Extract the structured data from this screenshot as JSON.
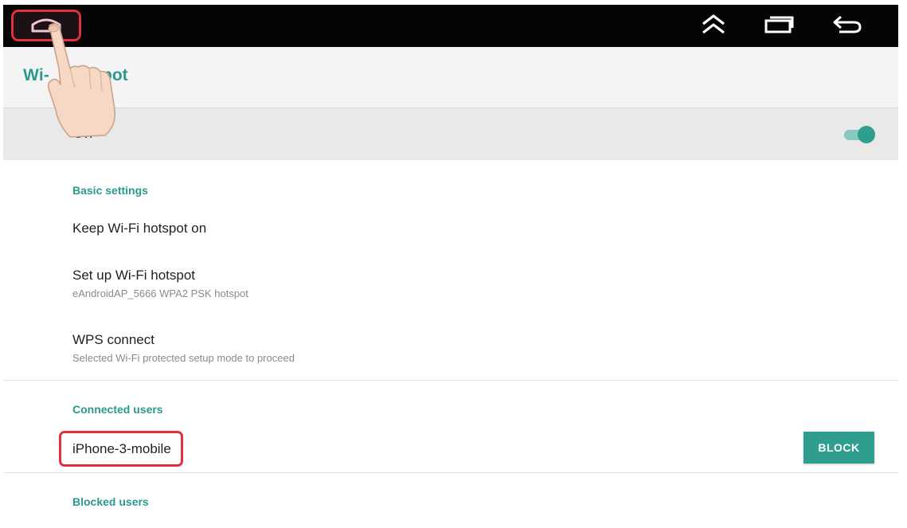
{
  "nav": {
    "home_icon": "home-icon",
    "recents_up_icon": "double-chevron-up-icon",
    "recent_apps_icon": "recent-apps-icon",
    "back_icon": "back-arrow-icon"
  },
  "header": {
    "title_visible_start": "Wi-",
    "title_visible_end": "pot"
  },
  "master_switch": {
    "label": "On",
    "state": "on",
    "accent_color": "#2f9e8f"
  },
  "basic_settings": {
    "section_label": "Basic settings",
    "items": [
      {
        "title": "Keep Wi-Fi hotspot on",
        "subtitle": ""
      },
      {
        "title": "Set up Wi-Fi hotspot",
        "subtitle": "eAndroidAP_5666 WPA2 PSK hotspot"
      },
      {
        "title": "WPS connect",
        "subtitle": "Selected Wi-Fi protected setup mode to proceed"
      }
    ]
  },
  "connected_users": {
    "section_label": "Connected users",
    "users": [
      {
        "name": "iPhone-3-mobile",
        "action_label": "BLOCK"
      }
    ]
  },
  "blocked_users": {
    "section_label": "Blocked users"
  },
  "colors": {
    "accent": "#2a9a8e",
    "highlight_box": "#e0303a",
    "system_bar": "#050505"
  }
}
